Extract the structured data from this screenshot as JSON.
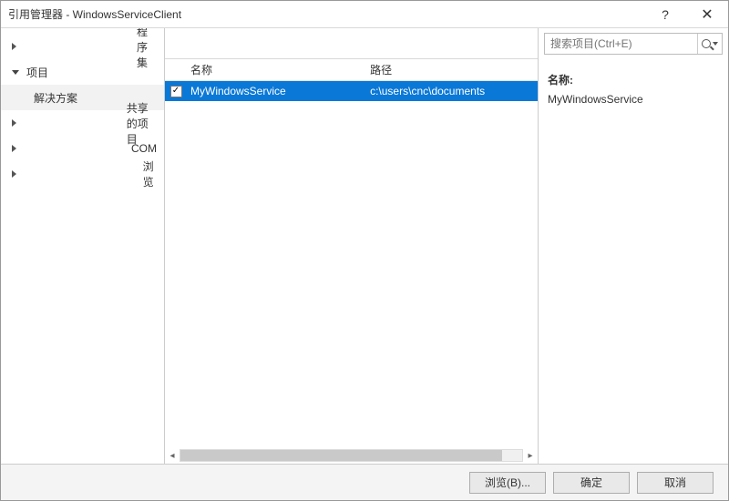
{
  "title": "引用管理器 - WindowsServiceClient",
  "titlebar": {
    "help": "?",
    "close": "✕"
  },
  "search": {
    "placeholder": "搜索项目(Ctrl+E)"
  },
  "nav": {
    "assemblies": "程序集",
    "projects": "项目",
    "solution": "解决方案",
    "shared": "共享的项目",
    "com": "COM",
    "browse": "浏览"
  },
  "grid": {
    "headers": {
      "name": "名称",
      "path": "路径"
    },
    "rows": [
      {
        "checked": true,
        "name": "MyWindowsService",
        "path": "c:\\users\\cnc\\documents"
      }
    ]
  },
  "info": {
    "name_label": "名称:",
    "name_value": "MyWindowsService"
  },
  "footer": {
    "browse": "浏览(B)...",
    "ok": "确定",
    "cancel": "取消"
  }
}
